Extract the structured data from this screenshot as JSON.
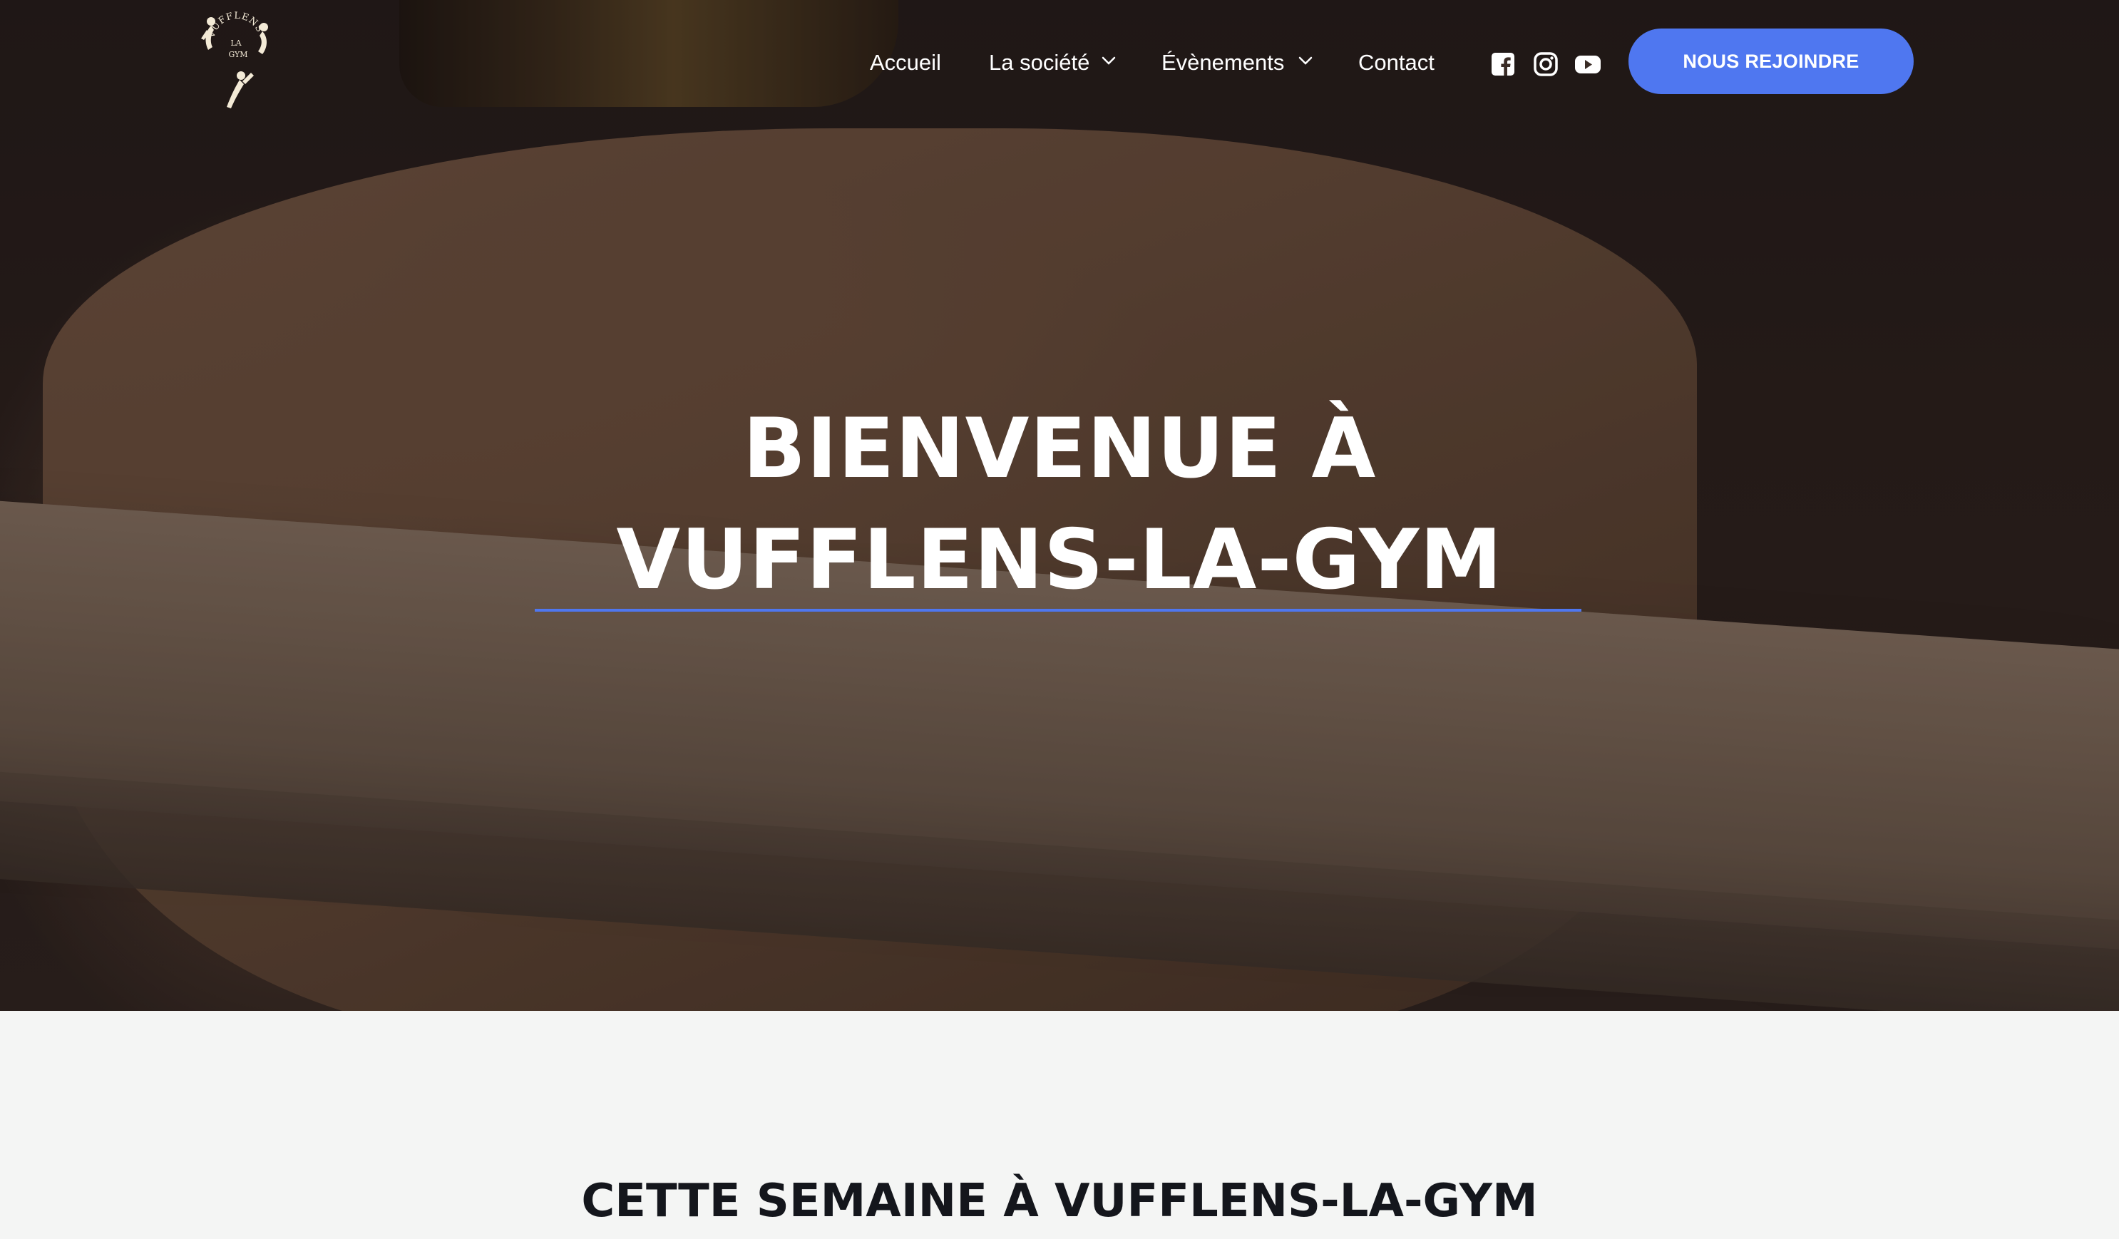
{
  "brand": {
    "logo_text": "VUFFLENS LA GYM",
    "logo_icon": "gymnasts-logo-icon"
  },
  "nav": {
    "items": [
      {
        "label": "Accueil"
      },
      {
        "label": "La société",
        "dropdown": true
      },
      {
        "label": "Évènements",
        "dropdown": true
      },
      {
        "label": "Contact"
      }
    ],
    "social": [
      {
        "icon": "facebook-icon"
      },
      {
        "icon": "instagram-icon"
      },
      {
        "icon": "youtube-icon"
      }
    ],
    "cta_label": "NOUS REJOINDRE"
  },
  "hero": {
    "title_line1": "BIENVENUE À",
    "title_line2": "VUFFLENS-LA-GYM"
  },
  "section": {
    "title": "CETTE SEMAINE À VUFFLENS-LA-GYM"
  },
  "colors": {
    "accent": "#4f77f0",
    "section_bg": "#f4f5f4",
    "heading_dark": "#14161c"
  }
}
